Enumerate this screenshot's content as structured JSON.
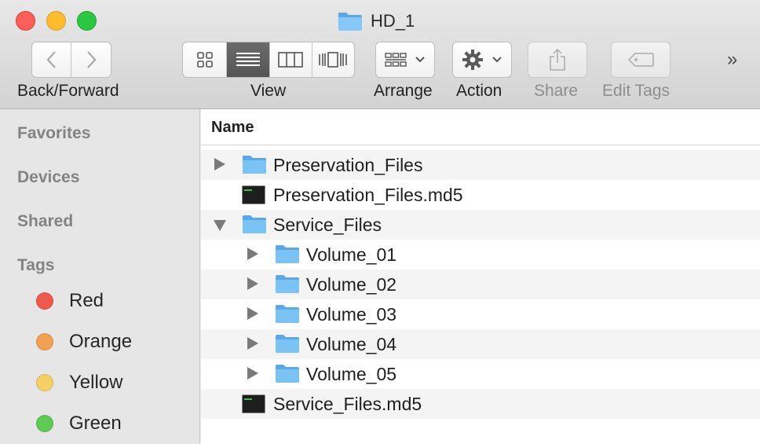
{
  "window": {
    "title": "HD_1",
    "title_icon": "folder-icon"
  },
  "toolbar": {
    "back_forward_label": "Back/Forward",
    "view_label": "View",
    "arrange_label": "Arrange",
    "action_label": "Action",
    "share_label": "Share",
    "edit_tags_label": "Edit Tags",
    "overflow_glyph": "»",
    "active_view": "list"
  },
  "sidebar": {
    "sections": [
      "Favorites",
      "Devices",
      "Shared",
      "Tags"
    ],
    "tags": [
      {
        "label": "Red",
        "color": "#f0584d"
      },
      {
        "label": "Orange",
        "color": "#f1a150"
      },
      {
        "label": "Yellow",
        "color": "#f5d163"
      },
      {
        "label": "Green",
        "color": "#5fcb55"
      }
    ]
  },
  "list": {
    "column_header": "Name",
    "rows": [
      {
        "name": "Preservation_Files",
        "type": "folder",
        "level": 0,
        "disclosure": "collapsed"
      },
      {
        "name": "Preservation_Files.md5",
        "type": "file",
        "level": 0,
        "disclosure": "none"
      },
      {
        "name": "Service_Files",
        "type": "folder",
        "level": 0,
        "disclosure": "expanded"
      },
      {
        "name": "Volume_01",
        "type": "folder",
        "level": 1,
        "disclosure": "collapsed"
      },
      {
        "name": "Volume_02",
        "type": "folder",
        "level": 1,
        "disclosure": "collapsed"
      },
      {
        "name": "Volume_03",
        "type": "folder",
        "level": 1,
        "disclosure": "collapsed"
      },
      {
        "name": "Volume_04",
        "type": "folder",
        "level": 1,
        "disclosure": "collapsed"
      },
      {
        "name": "Volume_05",
        "type": "folder",
        "level": 1,
        "disclosure": "collapsed"
      },
      {
        "name": "Service_Files.md5",
        "type": "file",
        "level": 0,
        "disclosure": "none"
      }
    ]
  },
  "colors": {
    "folder": "#7cc3f5",
    "folder_dark": "#5aa9e6",
    "selection_dark": "#5c5c5c"
  }
}
